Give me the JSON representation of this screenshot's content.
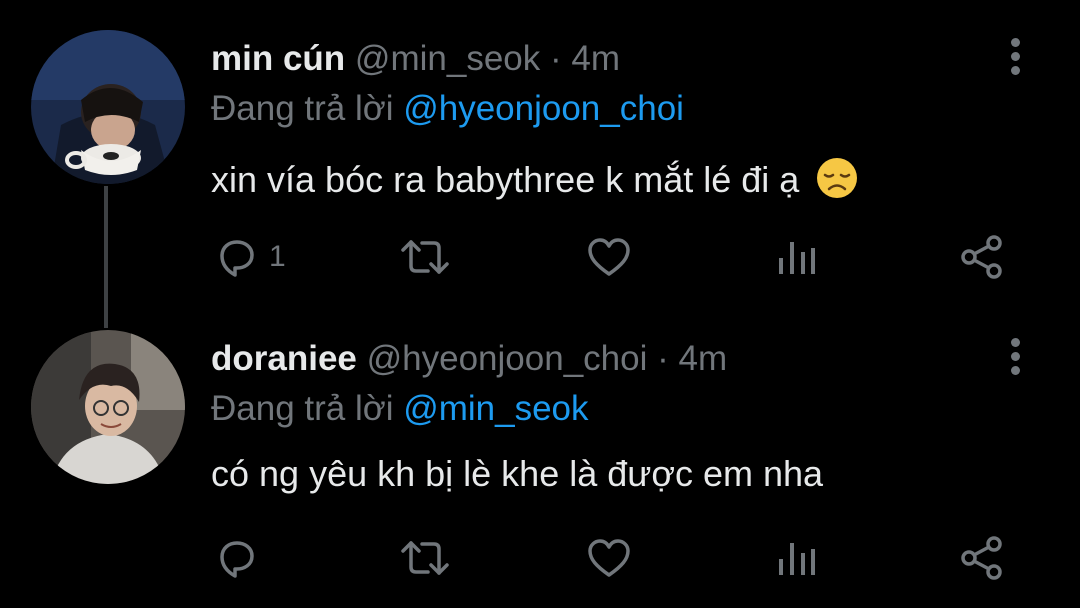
{
  "tweets": [
    {
      "name": "min cún",
      "handle": "@min_seok",
      "dot": "·",
      "time": "4m",
      "replying_prefix": "Đang trả lời",
      "replying_to": "@hyeonjoon_choi",
      "text": "xin vía bóc ra babythree k mắt lé đi ạ",
      "emoji": "disappointed-face",
      "reply_count": "1",
      "avatar": "photo-person-drinking-from-cup"
    },
    {
      "name": "doraniee",
      "handle": "@hyeonjoon_choi",
      "dot": "·",
      "time": "4m",
      "replying_prefix": "Đang trả lời",
      "replying_to": "@min_seok",
      "text": "có ng yêu kh bị lè khe là được em nha",
      "reply_count": "",
      "avatar": "photo-person-smiling-glasses"
    }
  ],
  "colors": {
    "background": "#000000",
    "text": "#e7e9ea",
    "muted": "#71767b",
    "mention": "#1d9bf0",
    "thread_line": "#3e4144"
  },
  "icons": [
    "reply-icon",
    "retweet-icon",
    "like-icon",
    "views-icon",
    "share-icon",
    "more-icon"
  ]
}
